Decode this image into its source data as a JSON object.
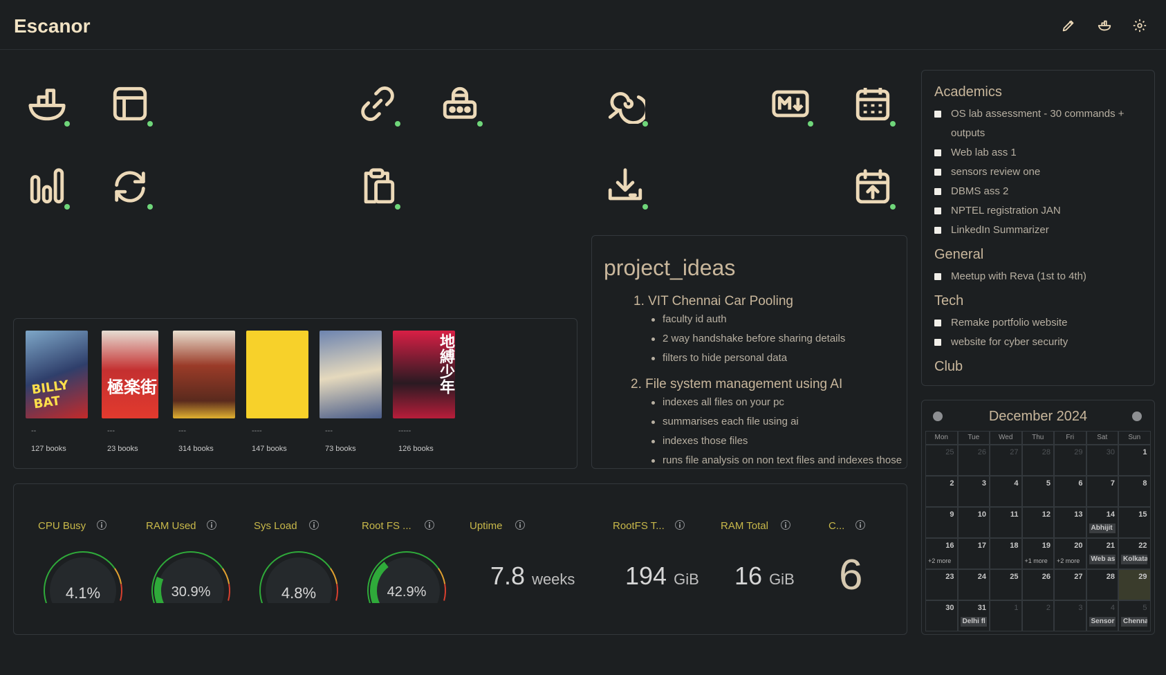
{
  "app": {
    "title": "Escanor"
  },
  "top_icons": [
    "edit-icon",
    "docker-icon",
    "settings-icon"
  ],
  "colors": {
    "background": "#1c1f21",
    "accent": "#ecd9b8",
    "status_online": "#6fd67a",
    "gauge_green": "#2faa3a",
    "label_yellow": "#c8b84a"
  },
  "books": [
    {
      "title": "--",
      "count": "127 books"
    },
    {
      "title": "---",
      "count": "23 books"
    },
    {
      "title": "---",
      "count": "314 books"
    },
    {
      "title": "----",
      "count": "147 books"
    },
    {
      "title": "---",
      "count": "73 books"
    },
    {
      "title": "-----",
      "count": "126 books"
    }
  ],
  "project_ideas": {
    "title": "project_ideas",
    "sections": [
      {
        "heading": "1. VIT Chennai Car Pooling",
        "items": [
          "faculty id auth",
          "2 way handshake before sharing details",
          "filters to hide personal data"
        ]
      },
      {
        "heading": "2. File system management using AI",
        "items": [
          "indexes all files on your pc",
          "summarises each file using ai",
          "indexes those files",
          "runs file analysis on non text files and indexes those"
        ]
      }
    ]
  },
  "todo": [
    {
      "heading": "Academics",
      "items": [
        "OS lab assessment - 30 commands + outputs",
        "Web lab ass 1",
        "sensors review one",
        "DBMS ass 2",
        "NPTEL registration JAN",
        "LinkedIn Summarizer"
      ]
    },
    {
      "heading": "General",
      "items": [
        "Meetup with Reva (1st to 4th)"
      ]
    },
    {
      "heading": "Tech",
      "items": [
        "Remake portfolio website",
        "website for cyber security"
      ]
    },
    {
      "heading": "Club",
      "items": []
    }
  ],
  "calendar": {
    "month": "December 2024",
    "days": [
      "Mon",
      "Tue",
      "Wed",
      "Thu",
      "Fri",
      "Sat",
      "Sun"
    ],
    "weeks": [
      [
        {
          "d": "25",
          "dim": true
        },
        {
          "d": "26",
          "dim": true
        },
        {
          "d": "27",
          "dim": true
        },
        {
          "d": "28",
          "dim": true
        },
        {
          "d": "29",
          "dim": true
        },
        {
          "d": "30",
          "dim": true
        },
        {
          "d": "1"
        }
      ],
      [
        {
          "d": "2"
        },
        {
          "d": "3"
        },
        {
          "d": "4"
        },
        {
          "d": "5"
        },
        {
          "d": "6"
        },
        {
          "d": "7"
        },
        {
          "d": "8"
        }
      ],
      [
        {
          "d": "9"
        },
        {
          "d": "10"
        },
        {
          "d": "11"
        },
        {
          "d": "12"
        },
        {
          "d": "13"
        },
        {
          "d": "14",
          "ev": "Abhijit"
        },
        {
          "d": "15"
        }
      ],
      [
        {
          "d": "16",
          "more": "+2 more"
        },
        {
          "d": "17"
        },
        {
          "d": "18"
        },
        {
          "d": "19",
          "more": "+1 more"
        },
        {
          "d": "20",
          "more": "+2 more"
        },
        {
          "d": "21",
          "ev": "Web as"
        },
        {
          "d": "22",
          "ev": "Kolkata"
        }
      ],
      [
        {
          "d": "23"
        },
        {
          "d": "24"
        },
        {
          "d": "25"
        },
        {
          "d": "26"
        },
        {
          "d": "27"
        },
        {
          "d": "28"
        },
        {
          "d": "29",
          "today": true
        }
      ],
      [
        {
          "d": "30"
        },
        {
          "d": "31",
          "ev": "Delhi fl"
        },
        {
          "d": "1",
          "dim": true
        },
        {
          "d": "2",
          "dim": true
        },
        {
          "d": "3",
          "dim": true
        },
        {
          "d": "4",
          "dim": true,
          "ev": "Sensor"
        },
        {
          "d": "5",
          "dim": true,
          "ev": "Chenna"
        }
      ]
    ]
  },
  "glances": {
    "gauges": [
      {
        "label": "CPU Busy",
        "value": "4.1%",
        "percent": 4.1
      },
      {
        "label": "RAM Used",
        "value": "30.9%",
        "percent": 30.9
      },
      {
        "label": "Sys Load",
        "value": "4.8%",
        "percent": 4.8
      },
      {
        "label": "Root FS ...",
        "value": "42.9%",
        "percent": 42.9
      }
    ],
    "stats": [
      {
        "label": "Uptime",
        "value": "7.8",
        "unit": "weeks"
      },
      {
        "label": "RootFS T...",
        "value": "194",
        "unit": "GiB"
      },
      {
        "label": "RAM Total",
        "value": "16",
        "unit": "GiB"
      },
      {
        "label": "C...",
        "value": "6",
        "unit": ""
      }
    ]
  }
}
